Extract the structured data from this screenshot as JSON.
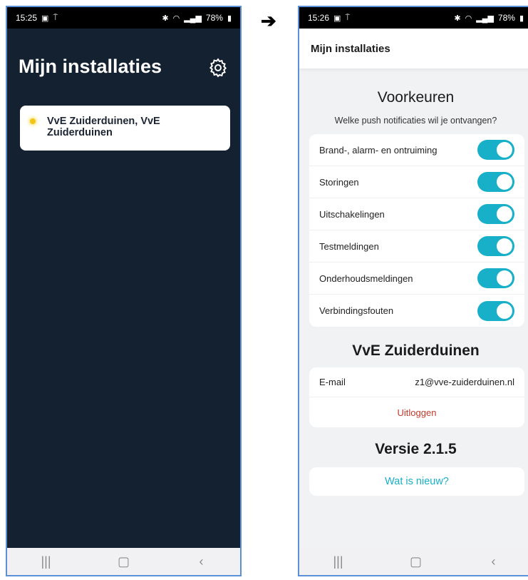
{
  "arrow": "➔",
  "left": {
    "status": {
      "time": "15:25",
      "battery": "78%"
    },
    "title": "Mijn installaties",
    "installation": "VvE Zuiderduinen, VvE Zuiderduinen"
  },
  "right": {
    "status": {
      "time": "15:26",
      "battery": "78%"
    },
    "header_title": "Mijn installaties",
    "preferences": {
      "title": "Voorkeuren",
      "subtitle": "Welke push notificaties wil je ontvangen?",
      "items": [
        {
          "label": "Brand-, alarm- en ontruiming",
          "enabled": true
        },
        {
          "label": "Storingen",
          "enabled": true
        },
        {
          "label": "Uitschakelingen",
          "enabled": true
        },
        {
          "label": "Testmeldingen",
          "enabled": true
        },
        {
          "label": "Onderhoudsmeldingen",
          "enabled": true
        },
        {
          "label": "Verbindingsfouten",
          "enabled": true
        }
      ]
    },
    "account": {
      "title": "VvE Zuiderduinen",
      "email_label": "E-mail",
      "email_value": "z1@vve-zuiderduinen.nl",
      "logout_label": "Uitloggen"
    },
    "version": {
      "title": "Versie 2.1.5",
      "news_link": "Wat is nieuw?"
    }
  },
  "colors": {
    "accent": "#18b0c8",
    "dark_bg": "#142131",
    "logout": "#c0392b"
  },
  "icons": {
    "settings": "gear-icon",
    "nav": [
      "recent-apps-icon",
      "home-icon",
      "back-icon"
    ]
  }
}
